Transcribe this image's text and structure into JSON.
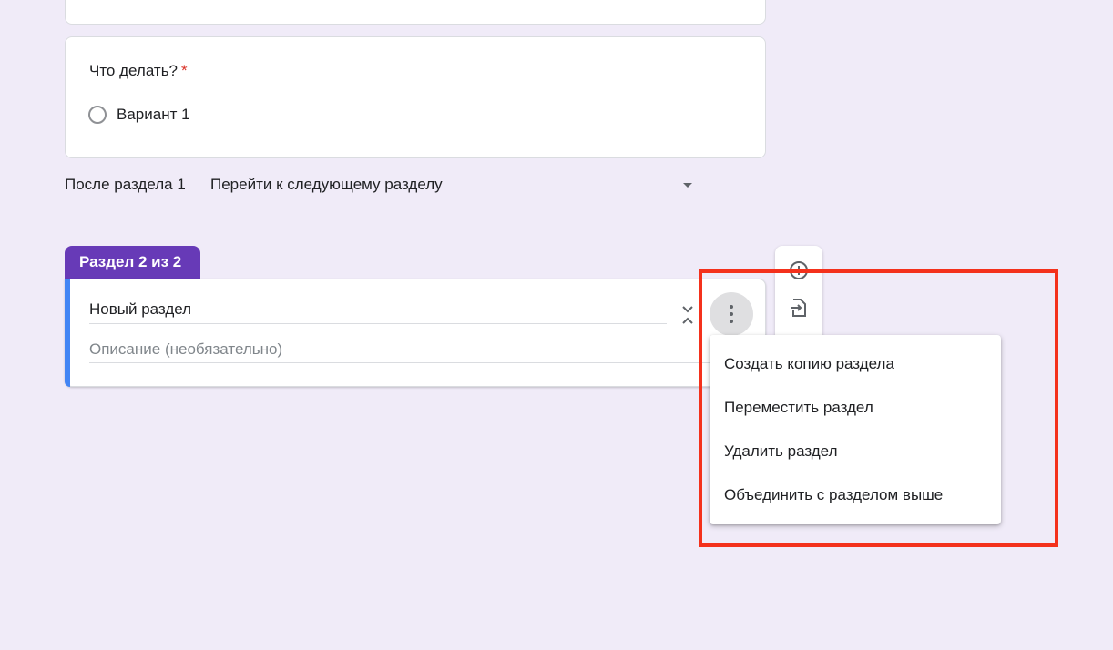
{
  "question": {
    "title": "Что делать?",
    "required_mark": "*",
    "option_label": "Вариант 1"
  },
  "navigation": {
    "after_section_label": "После раздела 1",
    "goto_value": "Перейти к следующему разделу"
  },
  "section": {
    "tab_label": "Раздел 2 из 2",
    "title": "Новый раздел",
    "description_placeholder": "Описание (необязательно)"
  },
  "menu": {
    "items": [
      {
        "label": "Создать копию раздела"
      },
      {
        "label": "Переместить раздел"
      },
      {
        "label": "Удалить раздел"
      },
      {
        "label": "Объединить с разделом выше"
      }
    ]
  },
  "colors": {
    "background": "#f0ebf8",
    "section_tab": "#673ab7",
    "accent_bar": "#4285f4",
    "highlight_box": "#f4311c",
    "required": "#d93025"
  },
  "icons": [
    "radio-icon",
    "dropdown-caret-icon",
    "collapse-icon",
    "more-vert-icon",
    "add-circle-icon",
    "import-questions-icon"
  ]
}
